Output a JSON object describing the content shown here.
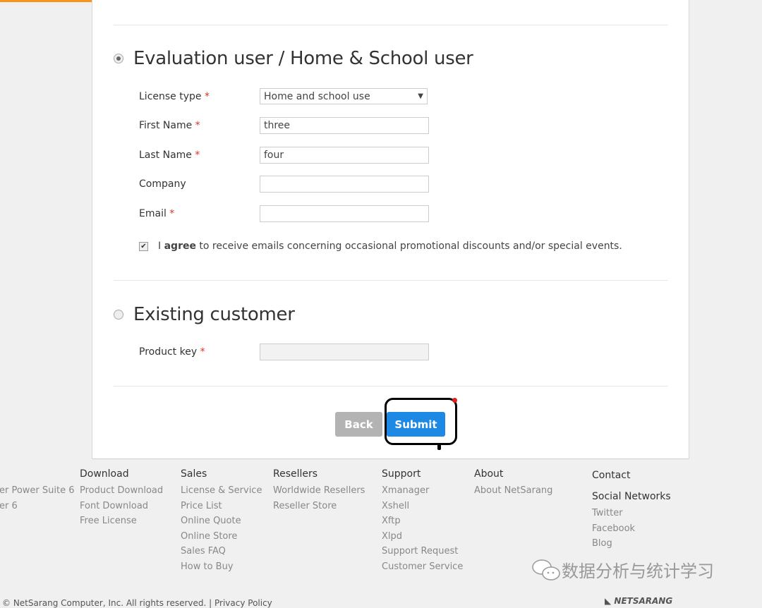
{
  "colors": {
    "accent": "#f7941d",
    "submit": "#1e88e5",
    "back": "#b3b3b3",
    "required": "#d9342b"
  },
  "evaluation": {
    "title": "Evaluation user / Home & School user",
    "selected": true,
    "license_type": {
      "label": "License type",
      "value": "Home and school use"
    },
    "first_name": {
      "label": "First Name",
      "value": "three"
    },
    "last_name": {
      "label": "Last Name",
      "value": "four"
    },
    "company": {
      "label": "Company",
      "value": ""
    },
    "email": {
      "label": "Email",
      "value": ""
    },
    "agree": {
      "checked": true,
      "pre": "I ",
      "bold": "agree",
      "rest": " to receive emails concerning occasional promotional discounts and/or special events."
    }
  },
  "existing": {
    "title": "Existing customer",
    "selected": false,
    "product_key": {
      "label": "Product key",
      "value": ""
    }
  },
  "required_mark": "*",
  "buttons": {
    "back": "Back",
    "submit": "Submit"
  },
  "footer": {
    "partial": [
      "er Power Suite 6",
      "er 6"
    ],
    "columns": [
      {
        "title": "Download",
        "links": [
          "Product Download",
          "Font Download",
          "Free License"
        ]
      },
      {
        "title": "Sales",
        "links": [
          "License & Service",
          "Price List",
          "Online Quote",
          "Online Store",
          "Sales FAQ",
          "How to Buy"
        ]
      },
      {
        "title": "Resellers",
        "links": [
          "Worldwide Resellers",
          "Reseller Store"
        ]
      },
      {
        "title": "Support",
        "links": [
          "Xmanager",
          "Xshell",
          "Xftp",
          "Xlpd",
          "Support Request",
          "Customer Service"
        ]
      },
      {
        "title": "About",
        "links": [
          "About NetSarang"
        ]
      }
    ],
    "contact": "Contact",
    "social": {
      "title": "Social Networks",
      "links": [
        "Twitter",
        "Facebook",
        "Blog"
      ]
    },
    "copyright": "© NetSarang Computer, Inc. All rights reserved.",
    "privacy": "Privacy Policy",
    "logo": "NETSARANG"
  },
  "watermark": "数据分析与统计学习"
}
